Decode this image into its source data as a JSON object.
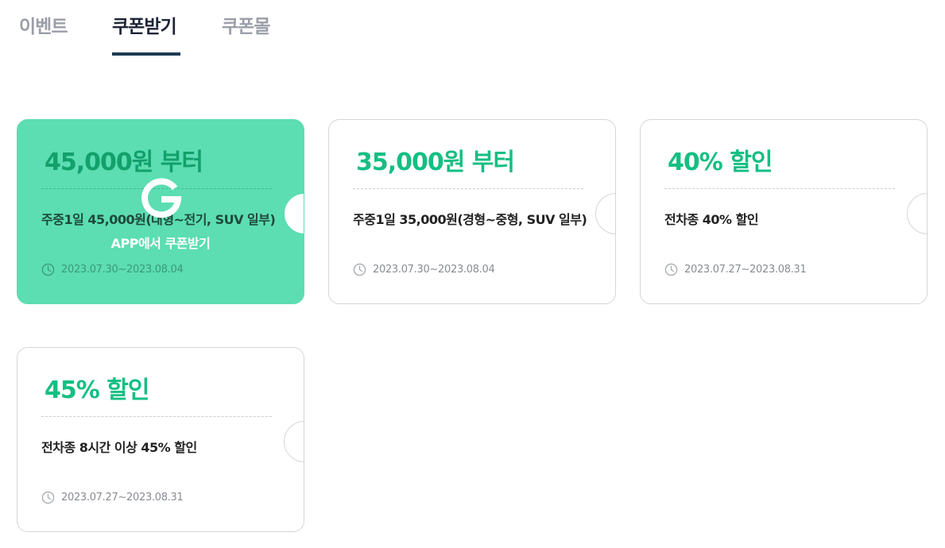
{
  "tabs": [
    {
      "label": "이벤트",
      "active": false
    },
    {
      "label": "쿠폰받기",
      "active": true
    },
    {
      "label": "쿠폰몰",
      "active": false
    }
  ],
  "coupons": [
    {
      "title": "45,000원 부터",
      "description": "주중1일 45,000원(대형~전기, SUV 일부)",
      "period": "2023.07.30~2023.08.04",
      "hover_label": "APP에서 쿠폰받기",
      "icon": "clock-icon"
    },
    {
      "title": "35,000원 부터",
      "description": "주중1일 35,000원(경형~중형, SUV 일부)",
      "period": "2023.07.30~2023.08.04",
      "icon": "clock-icon"
    },
    {
      "title": "40% 할인",
      "description": "전차종 40% 할인",
      "period": "2023.07.27~2023.08.31",
      "icon": "clock-icon"
    },
    {
      "title": "45% 할인",
      "description": "전차종 8시간 이상 45% 할인",
      "period": "2023.07.27~2023.08.31",
      "icon": "clock-icon"
    }
  ],
  "colors": {
    "accent_green": "#13bf82",
    "hover_green": "#5cddb2",
    "active_tab": "#1d2535",
    "inactive_tab": "#9a9ea8",
    "tab_underline": "#1d3a52"
  }
}
